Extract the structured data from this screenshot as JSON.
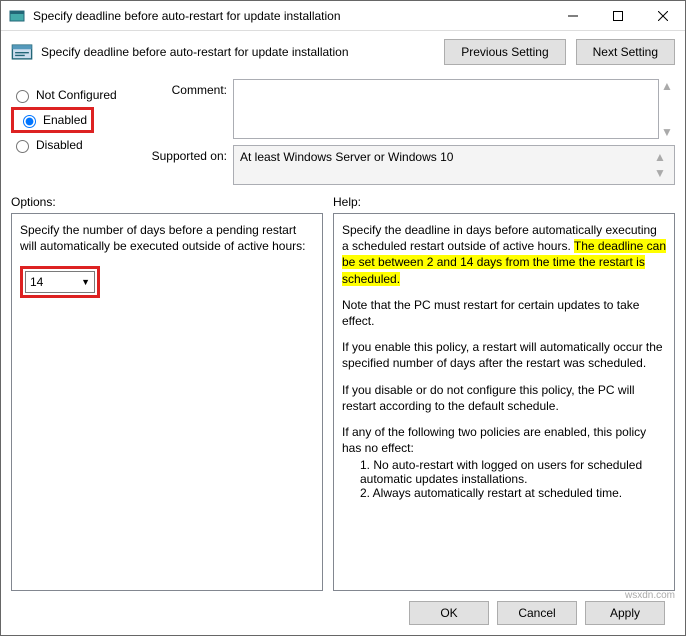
{
  "window": {
    "title": "Specify deadline before auto-restart for update installation"
  },
  "header": {
    "subtitle": "Specify deadline before auto-restart for update installation",
    "prev": "Previous Setting",
    "next": "Next Setting"
  },
  "radios": {
    "not_configured": "Not Configured",
    "enabled": "Enabled",
    "disabled": "Disabled"
  },
  "meta": {
    "comment_label": "Comment:",
    "comment_value": "",
    "supported_label": "Supported on:",
    "supported_value": "At least Windows Server or Windows 10"
  },
  "sections": {
    "options": "Options:",
    "help": "Help:"
  },
  "options": {
    "description": "Specify the number of days before a pending restart will automatically be executed outside of active hours:",
    "value": "14"
  },
  "help": {
    "p1a": "Specify the deadline in days before automatically executing a scheduled restart outside of active hours. ",
    "p1b": "The deadline can be set between 2 and 14 days from the time the restart is scheduled.",
    "p2": "Note that the PC must restart for certain updates to take effect.",
    "p3": "If you enable this policy, a restart will automatically occur the specified number of days after the restart was scheduled.",
    "p4": "If you disable or do not configure this policy, the PC will restart according to the default schedule.",
    "p5": "If any of the following two policies are enabled, this policy has no effect:",
    "li1": "1. No auto-restart with logged on users for scheduled automatic updates installations.",
    "li2": "2. Always automatically restart at scheduled time."
  },
  "buttons": {
    "ok": "OK",
    "cancel": "Cancel",
    "apply": "Apply"
  },
  "watermark": "wsxdn.com"
}
